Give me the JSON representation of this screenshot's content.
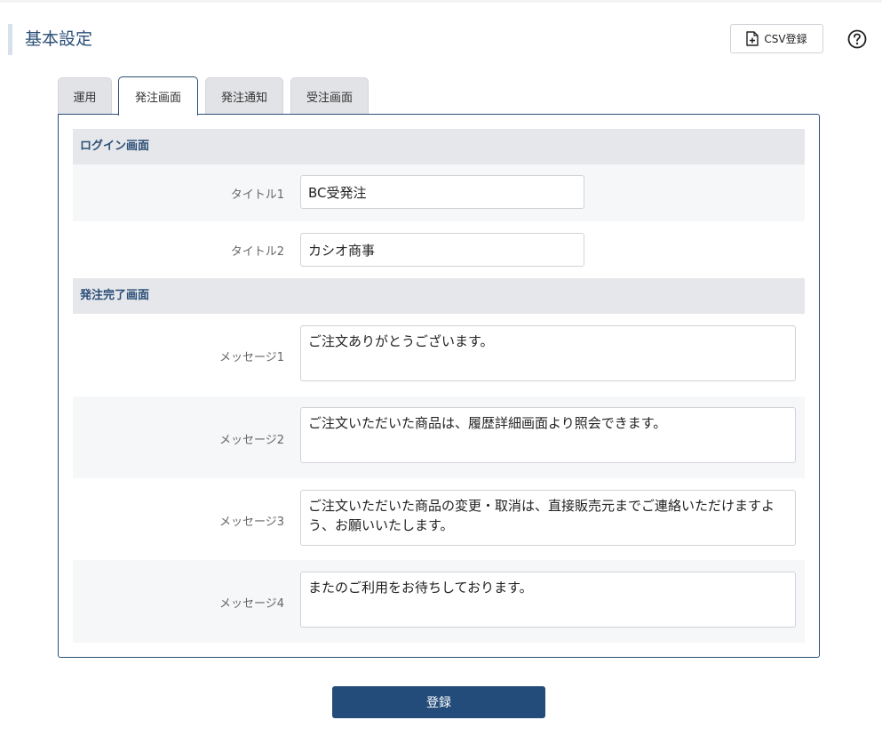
{
  "header": {
    "title": "基本設定",
    "csv_button_label": "CSV登録",
    "csv_icon": "file-plus-icon",
    "help_icon": "question-circle-icon"
  },
  "tabs": [
    {
      "label": "運用",
      "active": false
    },
    {
      "label": "発注画面",
      "active": true
    },
    {
      "label": "発注通知",
      "active": false
    },
    {
      "label": "受注画面",
      "active": false
    }
  ],
  "sections": {
    "login": {
      "heading": "ログイン画面",
      "fields": [
        {
          "label": "タイトル1",
          "value": "BC受発注"
        },
        {
          "label": "タイトル2",
          "value": "カシオ商事"
        }
      ]
    },
    "complete": {
      "heading": "発注完了画面",
      "fields": [
        {
          "label": "メッセージ1",
          "value": "ご注文ありがとうございます。"
        },
        {
          "label": "メッセージ2",
          "value": "ご注文いただいた商品は、履歴詳細画面より照会できます。"
        },
        {
          "label": "メッセージ3",
          "value": "ご注文いただいた商品の変更・取消は、直接販売元までご連絡いただけますよう、お願いいたします。"
        },
        {
          "label": "メッセージ4",
          "value": "またのご利用をお待ちしております。"
        }
      ]
    }
  },
  "footer": {
    "submit_label": "登録"
  },
  "colors": {
    "accent": "#2b4f78",
    "button": "#244c7a",
    "section_bg": "#e6e7ea",
    "row_shade": "#f6f7f9"
  }
}
